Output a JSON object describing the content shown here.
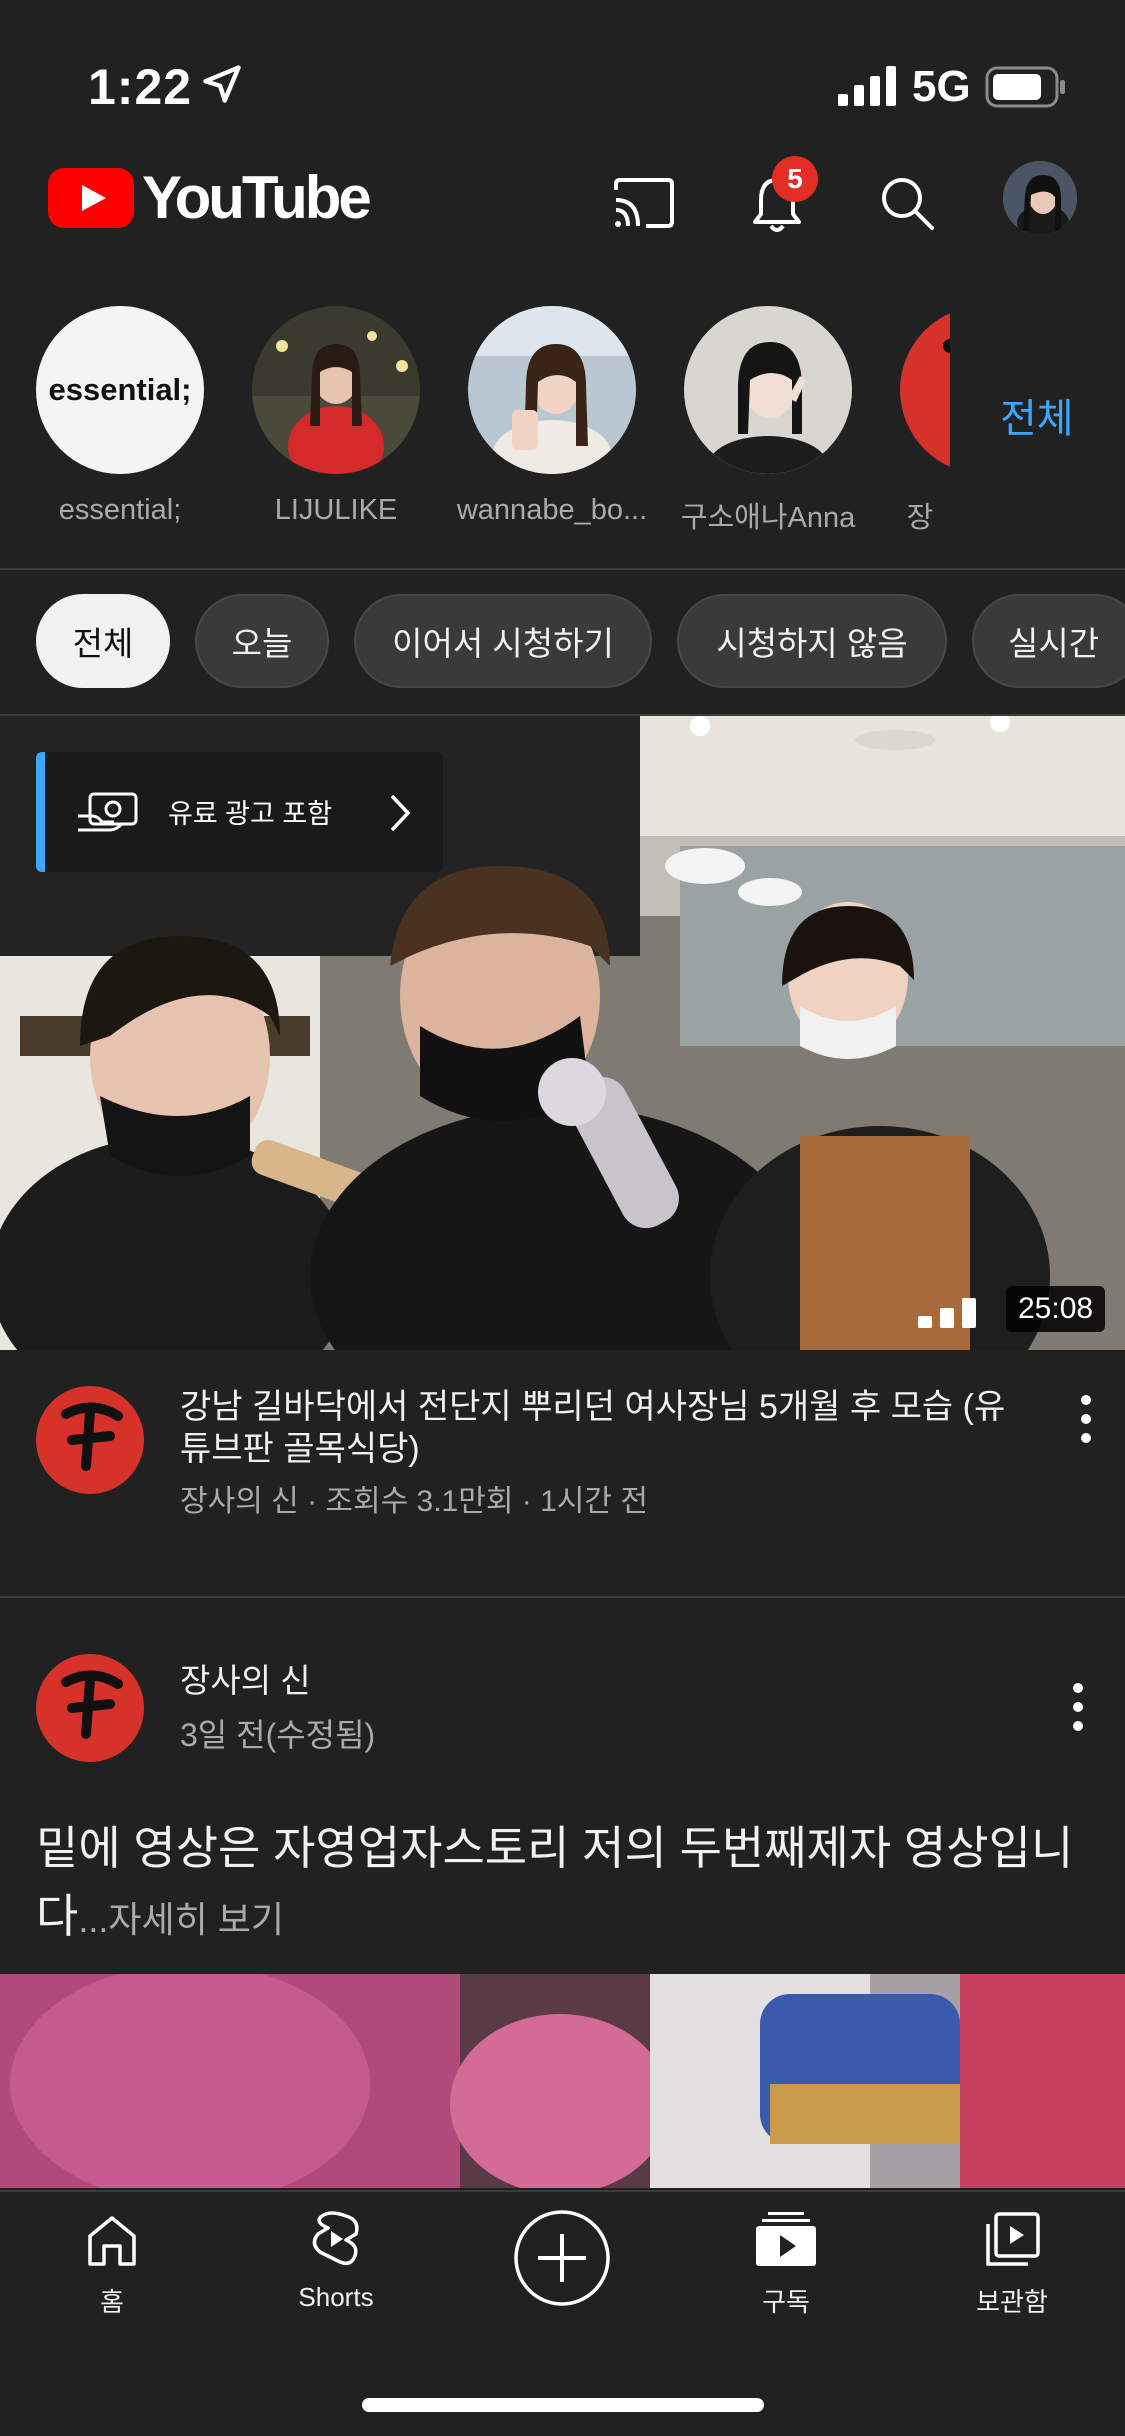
{
  "status_bar": {
    "time": "1:22",
    "network": "5G"
  },
  "header": {
    "logo_text": "YouTube",
    "notification_count": "5",
    "icons": [
      "cast-icon",
      "bell-icon",
      "search-icon",
      "avatar"
    ]
  },
  "channels": {
    "items": [
      {
        "name": "essential;",
        "logo_text": "essential;"
      },
      {
        "name": "LIJULIKE"
      },
      {
        "name": "wannabe_bo..."
      },
      {
        "name": "구소애나Anna"
      },
      {
        "name": "장"
      }
    ],
    "all_label": "전체"
  },
  "chips": [
    "전체",
    "오늘",
    "이어서 시청하기",
    "시청하지 않음",
    "실시간"
  ],
  "video1": {
    "ad_label": "유료 광고 포함",
    "duration": "25:08",
    "title": "강남 길바닥에서 전단지 뿌리던 여사장님 5개월 후 모습 (유튜브판 골목식당)",
    "meta": "장사의 신 · 조회수 3.1만회 · 1시간 전",
    "avatar_glyph": "장"
  },
  "post": {
    "channel": "장사의 신",
    "time": "3일 전(수정됨)",
    "text": "밑에 영상은 자영업자스토리 저의 두번째제자 영상입니다",
    "more_label": "...자세히 보기"
  },
  "bottom_nav": {
    "home": "홈",
    "shorts": "Shorts",
    "subscriptions": "구독",
    "library": "보관함"
  },
  "colors": {
    "accent": "#3ea6ff",
    "brand_red": "#ff0000",
    "background": "#212121"
  }
}
